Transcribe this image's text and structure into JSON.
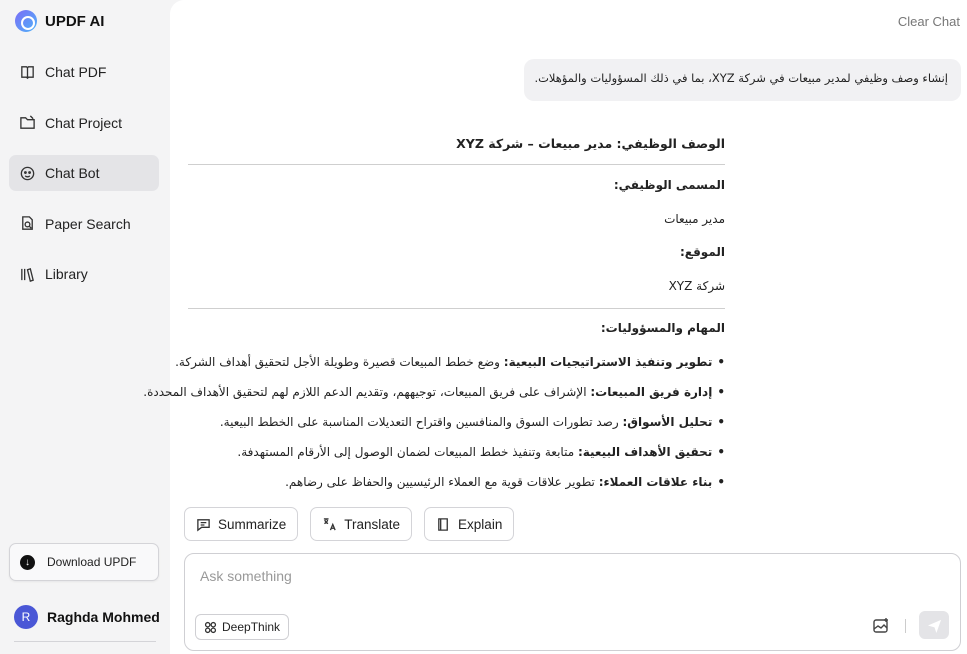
{
  "brand": {
    "name": "UPDF AI"
  },
  "sidebar": {
    "items": [
      {
        "label": "Chat PDF",
        "icon": "book-chat-icon"
      },
      {
        "label": "Chat Project",
        "icon": "folder-chat-icon"
      },
      {
        "label": "Chat Bot",
        "icon": "bot-icon",
        "active": true
      },
      {
        "label": "Paper Search",
        "icon": "paper-search-icon"
      },
      {
        "label": "Library",
        "icon": "library-icon"
      }
    ],
    "download_label": "Download UPDF",
    "user": {
      "initial": "R",
      "name": "Raghda Mohmed"
    }
  },
  "header": {
    "clear_label": "Clear Chat"
  },
  "chat": {
    "user_message": "إنشاء وصف وظيفي لمدير مبيعات في شركة XYZ، بما في ذلك المسؤوليات والمؤهلات.",
    "answer": {
      "heading": "الوصف الوظيفي: مدير مبيعات – شركة XYZ",
      "title_label": "المسمى الوظيفي:",
      "title_value": "مدير مبيعات",
      "location_label": "الموقع:",
      "location_value": "شركة XYZ",
      "duties_label": "المهام والمسؤوليات:",
      "duties": [
        {
          "bold": "تطوير وتنفيذ الاستراتيجيات البيعية:",
          "text": " وضع خطط المبيعات قصيرة وطويلة الأجل لتحقيق أهداف الشركة."
        },
        {
          "bold": "إدارة فريق المبيعات:",
          "text": " الإشراف على فريق المبيعات، توجيههم، وتقديم الدعم اللازم لهم لتحقيق الأهداف المحددة."
        },
        {
          "bold": "تحليل الأسواق:",
          "text": " رصد تطورات السوق والمنافسين واقتراح التعديلات المناسبة على الخطط البيعية."
        },
        {
          "bold": "تحقيق الأهداف البيعية:",
          "text": " متابعة وتنفيذ خطط المبيعات لضمان الوصول إلى الأرقام المستهدفة."
        },
        {
          "bold": "بناء علاقات العملاء:",
          "text": " تطوير علاقات قوية مع العملاء الرئيسيين والحفاظ على رضاهم."
        }
      ]
    }
  },
  "actions": {
    "summarize": "Summarize",
    "translate": "Translate",
    "explain": "Explain"
  },
  "composer": {
    "placeholder": "Ask something",
    "deepthink_label": "DeepThink"
  }
}
